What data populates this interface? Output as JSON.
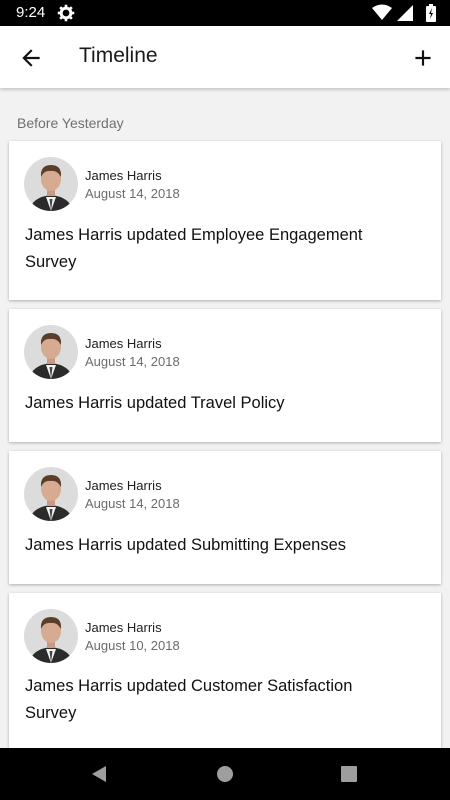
{
  "status": {
    "time": "9:24"
  },
  "appbar": {
    "title": "Timeline"
  },
  "section_header": "Before Yesterday",
  "cards": [
    {
      "author": "James Harris",
      "date": "August 14, 2018",
      "text": "James Harris updated Employee Engagement Survey"
    },
    {
      "author": "James Harris",
      "date": "August 14, 2018",
      "text": "James Harris updated Travel Policy"
    },
    {
      "author": "James Harris",
      "date": "August 14, 2018",
      "text": "James Harris updated Submitting Expenses"
    },
    {
      "author": "James Harris",
      "date": "August 10, 2018",
      "text": "James Harris updated Customer Satisfaction Survey"
    }
  ],
  "icons": {
    "status": [
      "gear-icon",
      "wifi-icon",
      "signal-icon",
      "battery-icon"
    ],
    "appbar": [
      "back-arrow-icon",
      "add-icon"
    ],
    "navbar": [
      "back-triangle-icon",
      "home-circle-icon",
      "recents-square-icon"
    ]
  }
}
